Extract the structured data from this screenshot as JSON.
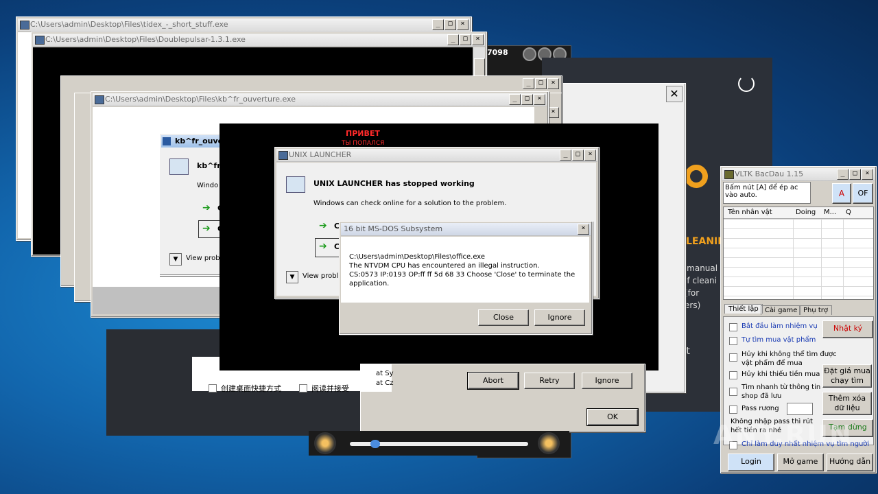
{
  "windows": {
    "tidex": {
      "title": "C:\\Users\\admin\\Desktop\\Files\\tidex_-_short_stuff.exe"
    },
    "doublepulsar": {
      "title": "C:\\Users\\admin\\Desktop\\Files\\Doublepulsar-1.3.1.exe"
    },
    "player": {
      "title_fragment": "7098"
    },
    "kbfr": {
      "title": "C:\\Users\\admin\\Desktop\\Files\\kb^fr_ouverture.exe"
    },
    "kbfr_dialog": {
      "title": "kb^fr_ouve",
      "heading": "kb^fr",
      "line": "Windo",
      "option1": "C",
      "option2": "C",
      "view_problem": "View probl"
    },
    "russian": {
      "line1": "ПРИВЕТ",
      "line2": "ТЫ ПОПАЛСЯ"
    },
    "unix": {
      "title": "UNIX LAUNCHER",
      "heading": "UNIX LAUNCHER has stopped working",
      "subtext": "Windows can check online for a solution to the problem.",
      "option1": "C",
      "option2": "C",
      "view_problem": "View probl"
    },
    "dos": {
      "title": "16 bit MS-DOS Subsystem",
      "line1": "C:\\Users\\admin\\Desktop\\Files\\office.exe",
      "line2": "The NTVDM CPU has encountered an illegal instruction.",
      "line3": "CS:0573 IP:0193 OP:ff ff 5d 68 33 Choose 'Close' to terminate the",
      "line4": "application.",
      "close": "Close",
      "ignore": "Ignore"
    },
    "abort_dialog": {
      "stack1": "at Sy",
      "stack2": "at Cz",
      "abort": "Abort",
      "retry": "Retry",
      "ignore": "Ignore",
      "ok": "OK"
    },
    "installer": {
      "opt1": "创建桌面快捷方式",
      "opt2": "阅读并接受"
    },
    "cleaner": {
      "cleaning": "LEANIN",
      "manual": "o manual",
      "of": "of cleani",
      "for": "(for",
      "ers": "ers)",
      "start": "art"
    },
    "vltk": {
      "title": "VLTK BacDau 1.15",
      "hint": "Bấm nút [A] để ép ac vào auto.",
      "btn_a": "A",
      "btn_of": "OF",
      "columns": [
        "Tên nhân vật",
        "Doing",
        "M...",
        "Q"
      ],
      "tabs": [
        "Thiết lập",
        "Cài game",
        "Phụ trợ"
      ],
      "options": [
        "Bắt đầu làm nhiệm vụ",
        "Tự tìm mua vật phẩm",
        "Hủy khi không thể tìm được vật phẩm để mua",
        "Hủy khi thiếu tiền mua",
        "Tìm nhanh từ thông tin shop đã lưu",
        "Pass rương"
      ],
      "note": "Không nhập pass thì rút hết tiền ra nhé",
      "last_option": "Chỉ làm duy nhất nhiệm vụ tìm người",
      "side_buttons": [
        "Nhật ký",
        "Đặt giá mua chạy tìm",
        "Thêm xóa dữ liệu",
        "Tạm dừng"
      ],
      "bottom_buttons": [
        "Login",
        "Mở game",
        "Hướng dẫn"
      ],
      "colors": {
        "red": "#cc0000",
        "blue": "#1a3bb3",
        "green": "#1a7a1a"
      }
    },
    "watermark": "ANY.RUN"
  }
}
